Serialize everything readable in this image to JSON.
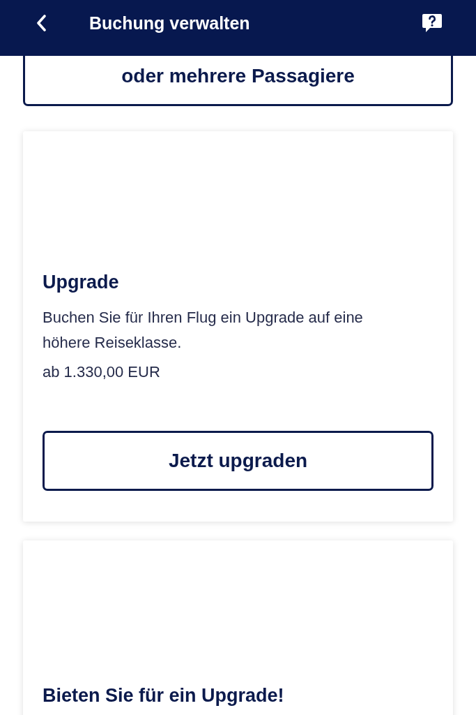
{
  "header": {
    "title": "Buchung verwalten"
  },
  "passengers_button": {
    "label": "oder mehrere Passagiere"
  },
  "cards": [
    {
      "title": "Upgrade",
      "description": "Buchen Sie für Ihren Flug ein Upgrade auf eine höhere Reiseklasse.",
      "price": "ab 1.330,00 EUR",
      "button": "Jetzt upgraden"
    },
    {
      "title": "Bieten Sie für ein Upgrade!"
    }
  ]
}
